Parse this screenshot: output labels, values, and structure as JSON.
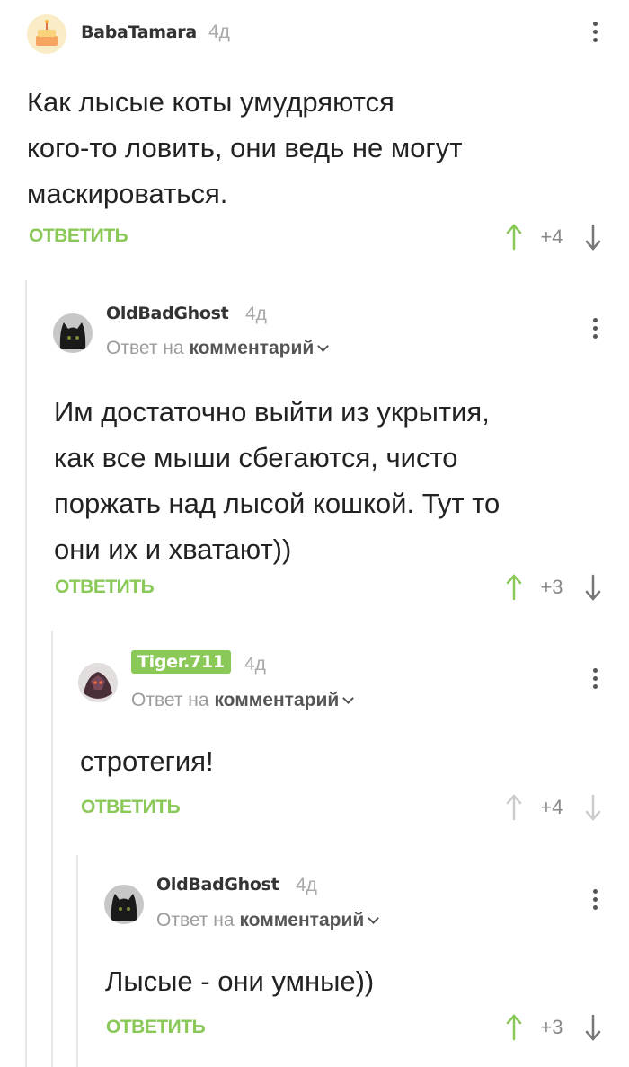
{
  "colors": {
    "accent": "#8ac858",
    "upvote": "#8ac858",
    "downvote": "#777777",
    "upvote_muted": "#cccccc",
    "downvote_muted": "#cccccc"
  },
  "reply_label": "ОТВЕТИТЬ",
  "comments": [
    {
      "username": "BabaTamara",
      "time": "4д",
      "avatar": "cake-avatar",
      "body": [
        "Как лысые коты умудряются",
        "кого-то ловить, они ведь не могут",
        "маскироваться."
      ],
      "score": "+4"
    },
    {
      "username": "OldBadGhost",
      "time": "4д",
      "avatar": "black-cat-avatar",
      "reply_prefix": "Ответ на",
      "reply_target": "комментарий",
      "body": [
        "Им достаточно выйти из укрытия,",
        "как все мыши сбегаются, чисто",
        "поржать над лысой кошкой. Тут то",
        "они их и хватают))"
      ],
      "score": "+3"
    },
    {
      "username": "Tiger.711",
      "time": "4д",
      "avatar": "warrior-avatar",
      "reply_prefix": "Ответ на",
      "reply_target": "комментарий",
      "body": [
        "стротегия!"
      ],
      "score": "+4"
    },
    {
      "username": "OldBadGhost",
      "time": "4д",
      "avatar": "black-cat-avatar",
      "reply_prefix": "Ответ на",
      "reply_target": "комментарий",
      "body": [
        "Лысые - они умные))"
      ],
      "score": "+3"
    }
  ]
}
